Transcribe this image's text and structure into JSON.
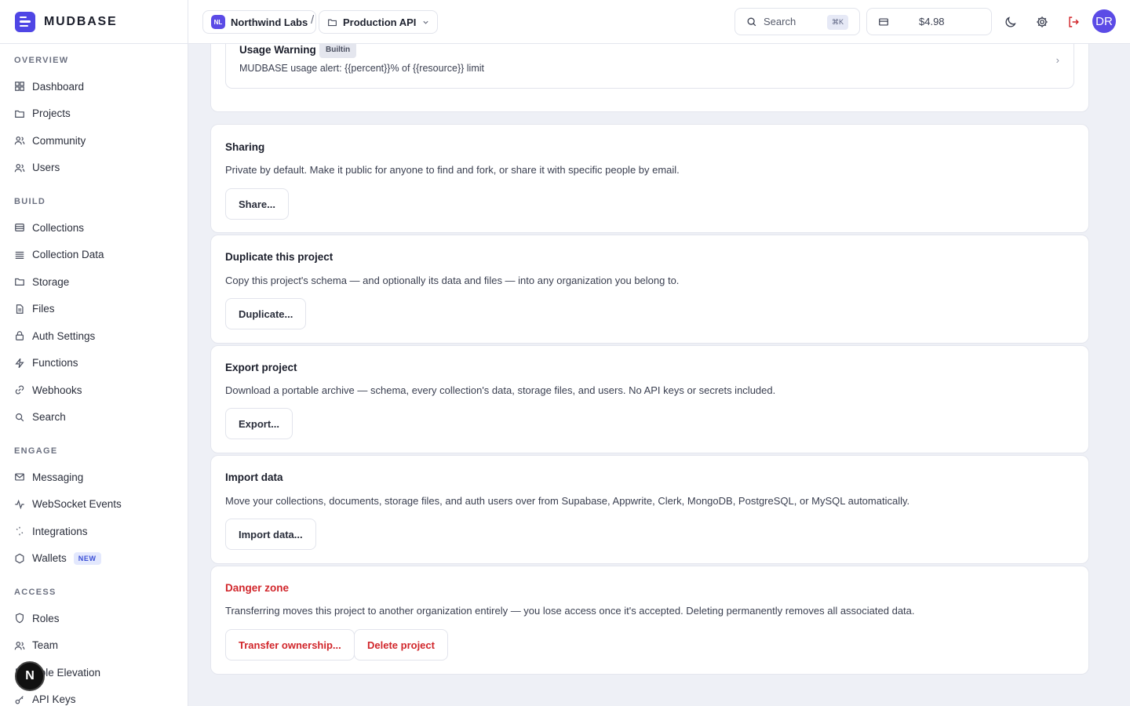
{
  "brand": {
    "name": "MUDBASE"
  },
  "sidebar": {
    "sections": [
      {
        "label": "OVERVIEW",
        "items": [
          "Dashboard",
          "Projects",
          "Community",
          "Users"
        ]
      },
      {
        "label": "BUILD",
        "items": [
          "Collections",
          "Collection Data",
          "Storage",
          "Files",
          "Auth Settings",
          "Functions",
          "Webhooks",
          "Search"
        ]
      },
      {
        "label": "ENGAGE",
        "items": [
          "Messaging",
          "WebSocket Events",
          "Integrations",
          "Wallets"
        ],
        "new_badge": "NEW"
      },
      {
        "label": "ACCESS",
        "items": [
          "Roles",
          "Team",
          "Role Elevation",
          "API Keys"
        ]
      }
    ],
    "fab_label": "N"
  },
  "topbar": {
    "org_initials": "NL",
    "org_name": "Northwind Labs",
    "separator": "/",
    "project_name": "Production API",
    "search_placeholder": "Search",
    "search_shortcut": "⌘K",
    "credits": "$4.98",
    "avatar_initials": "DR"
  },
  "template_row": {
    "name": "Usage Warning",
    "badge": "Builtin",
    "body": "MUDBASE usage alert: {{percent}}% of {{resource}} limit",
    "chevron": "›"
  },
  "cards": {
    "sharing": {
      "title": "Sharing",
      "desc": "Private by default. Make it public for anyone to find and fork, or share it with specific people by email.",
      "button": "Share..."
    },
    "duplicate": {
      "title": "Duplicate this project",
      "desc": "Copy this project's schema — and optionally its data and files — into any organization you belong to.",
      "button": "Duplicate..."
    },
    "export": {
      "title": "Export project",
      "desc": "Download a portable archive — schema, every collection's data, storage files, and users. No API keys or secrets included.",
      "button": "Export..."
    },
    "import": {
      "title": "Import data",
      "desc": "Move your collections, documents, storage files, and auth users over from Supabase, Appwrite, Clerk, MongoDB, PostgreSQL, or MySQL automatically.",
      "button": "Import data..."
    },
    "danger": {
      "title": "Danger zone",
      "desc": "Transferring moves this project to another organization entirely — you lose access once it's accepted. Deleting permanently removes all associated data.",
      "transfer_button": "Transfer ownership...",
      "delete_button": "Delete project"
    }
  },
  "colors": {
    "accent": "#4f46e5",
    "danger": "#d1262b",
    "background": "#eef0f6"
  }
}
